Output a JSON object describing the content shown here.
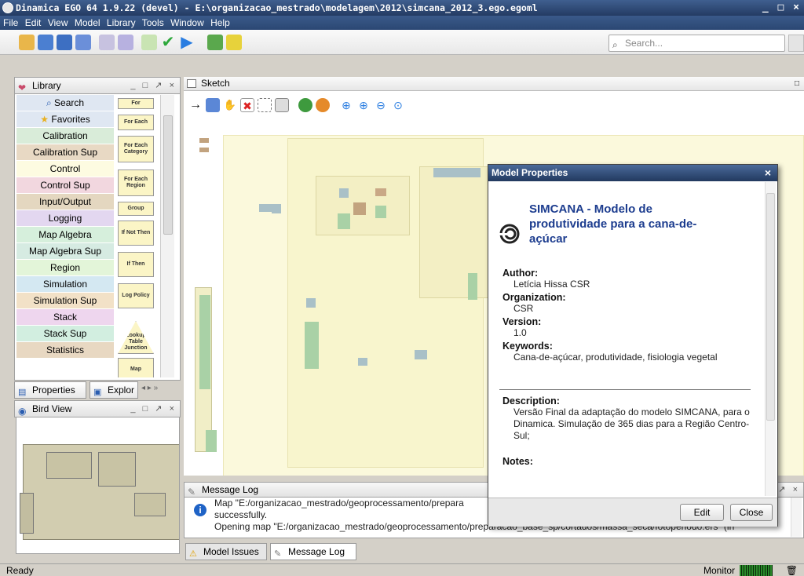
{
  "window": {
    "title": "Dinamica EGO 64 1.9.22 (devel) - E:\\organizacao_mestrado\\modelagem\\2012\\simcana_2012_3.ego.egoml"
  },
  "menu": [
    "File",
    "Edit",
    "View",
    "Model",
    "Library",
    "Tools",
    "Window",
    "Help"
  ],
  "toolbar": {
    "search_placeholder": "Search..."
  },
  "library": {
    "title": "Library",
    "items": [
      {
        "label": "Search",
        "color": "#dfe7f2"
      },
      {
        "label": "Favorites",
        "color": "#dfe7f2"
      },
      {
        "label": "Calibration",
        "color": "#d9ecd9"
      },
      {
        "label": "Calibration Sup",
        "color": "#e8d9c4"
      },
      {
        "label": "Control",
        "color": "#fdfbe1"
      },
      {
        "label": "Control Sup",
        "color": "#f2d7df"
      },
      {
        "label": "Input/Output",
        "color": "#e4d7c0"
      },
      {
        "label": "Logging",
        "color": "#e3d7f0"
      },
      {
        "label": "Map Algebra",
        "color": "#d6efdc"
      },
      {
        "label": "Map Algebra Sup",
        "color": "#d6ebe2"
      },
      {
        "label": "Region",
        "color": "#e3f5d9"
      },
      {
        "label": "Simulation",
        "color": "#d4e8f2"
      },
      {
        "label": "Simulation Sup",
        "color": "#f2e1c7"
      },
      {
        "label": "Stack",
        "color": "#eed6ee"
      },
      {
        "label": "Stack Sup",
        "color": "#d2eee0"
      },
      {
        "label": "Statistics",
        "color": "#e8d8c2"
      }
    ],
    "palette": [
      "For",
      "For Each",
      "For Each Category",
      "For Each Region",
      "Group",
      "If Not Then",
      "If Then",
      "Log Policy",
      "Lookup Table Junction",
      "Map"
    ]
  },
  "left_tabs": {
    "properties": "Properties",
    "explorer": "Explor"
  },
  "bird_view": {
    "title": "Bird View"
  },
  "sketch": {
    "title": "Sketch"
  },
  "model_properties": {
    "title": "Model Properties",
    "model_name": "SIMCANA - Modelo de produtividade para a cana-de-açúcar",
    "author_label": "Author:",
    "author": "Letícia Hissa CSR",
    "organization_label": "Organization:",
    "organization": "CSR",
    "version_label": "Version:",
    "version": "1.0",
    "keywords_label": "Keywords:",
    "keywords": "Cana-de-açúcar, produtividade, fisiologia vegetal",
    "description_label": "Description:",
    "description": "Versão Final da adaptação do modelo SIMCANA, para o Dinamica. Simulação de 365 dias para a Região Centro-Sul;",
    "notes_label": "Notes:",
    "edit_button": "Edit",
    "close_button": "Close"
  },
  "message_log": {
    "title": "Message Log",
    "line1": "Map \"E:/organizacao_mestrado/geoprocessamento/prepara",
    "line2": "successfully.",
    "line3": "Opening map \"E:/organizacao_mestrado/geoprocessamento/preparacao_base_sp/cortados/massa_seca/fotoperiodo.ers\" (in"
  },
  "bottom_tabs": {
    "model_issues": "Model Issues",
    "message_log": "Message Log"
  },
  "status": {
    "text": "Ready",
    "monitor": "Monitor"
  }
}
